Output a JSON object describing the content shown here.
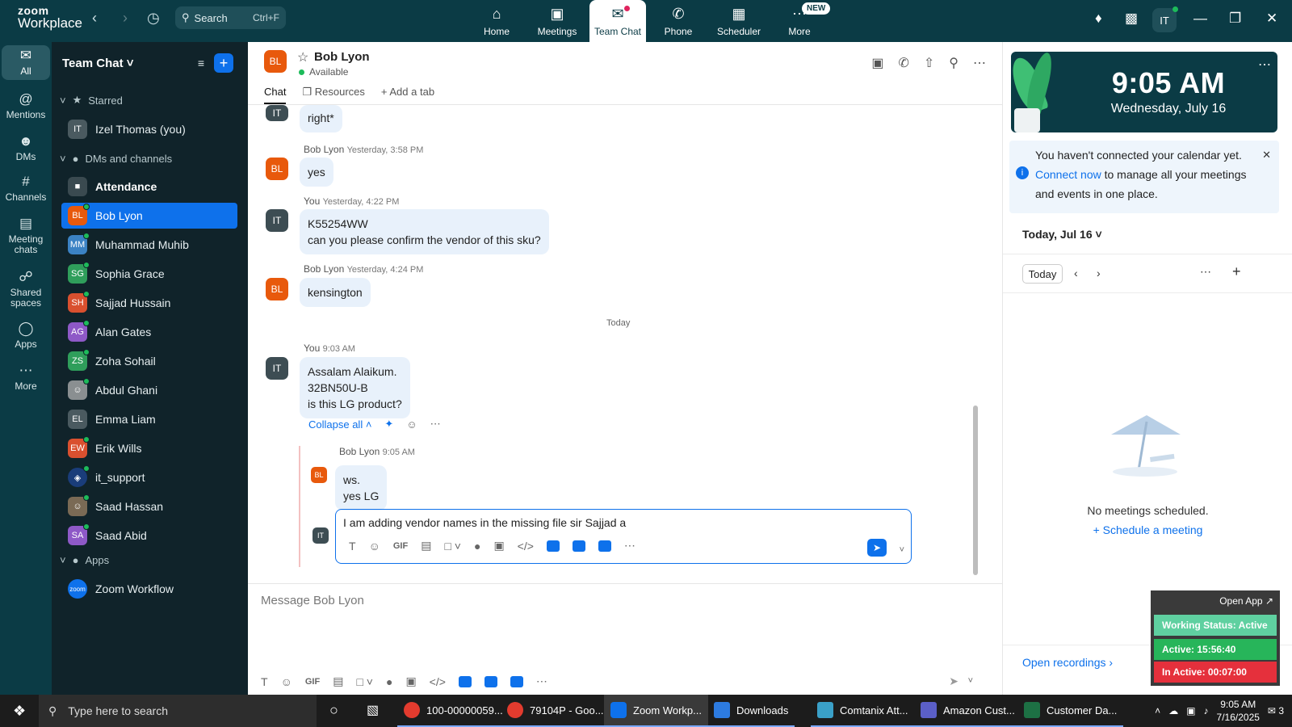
{
  "topbar": {
    "logo_line1": "zoom",
    "logo_line2": "Workplace",
    "search_label": "Search",
    "search_shortcut": "Ctrl+F",
    "tabs": [
      {
        "label": "Home",
        "icon": "home-icon"
      },
      {
        "label": "Meetings",
        "icon": "video-icon"
      },
      {
        "label": "Team Chat",
        "icon": "chat-icon"
      },
      {
        "label": "Phone",
        "icon": "phone-icon"
      },
      {
        "label": "Scheduler",
        "icon": "calendar-icon"
      },
      {
        "label": "More",
        "icon": "more-icon"
      }
    ],
    "new_badge": "NEW",
    "user_initials": "IT"
  },
  "rail": {
    "items": [
      {
        "label": "All"
      },
      {
        "label": "Mentions"
      },
      {
        "label": "DMs"
      },
      {
        "label": "Channels"
      },
      {
        "label": "Meeting chats"
      },
      {
        "label": "Shared spaces"
      },
      {
        "label": "Apps"
      },
      {
        "label": "More"
      }
    ]
  },
  "sidebar": {
    "title": "Team Chat",
    "starred_label": "Starred",
    "starred_items": [
      {
        "initials": "IT",
        "name": "Izel Thomas (you)"
      }
    ],
    "dms_label": "DMs and channels",
    "items": [
      {
        "initials": "",
        "name": "Attendance"
      },
      {
        "initials": "BL",
        "name": "Bob Lyon"
      },
      {
        "initials": "MM",
        "name": "Muhammad Muhib"
      },
      {
        "initials": "SG",
        "name": "Sophia Grace"
      },
      {
        "initials": "SH",
        "name": "Sajjad Hussain"
      },
      {
        "initials": "AG",
        "name": "Alan Gates"
      },
      {
        "initials": "ZS",
        "name": "Zoha Sohail"
      },
      {
        "initials": "",
        "name": "Abdul Ghani"
      },
      {
        "initials": "EL",
        "name": "Emma Liam"
      },
      {
        "initials": "EW",
        "name": "Erik Wills"
      },
      {
        "initials": "",
        "name": "it_support"
      },
      {
        "initials": "",
        "name": "Saad Hassan"
      },
      {
        "initials": "SA",
        "name": "Saad Abid"
      }
    ],
    "apps_label": "Apps",
    "apps": [
      {
        "name": "Zoom Workflow",
        "initials": "zoom"
      }
    ]
  },
  "chat": {
    "contact_initials": "BL",
    "contact_name": "Bob Lyon",
    "contact_status": "Available",
    "tabs": [
      "Chat",
      "Resources",
      "Add a tab"
    ],
    "messages": [
      {
        "initials": "IT",
        "sender": "",
        "time": "",
        "text": "right*"
      },
      {
        "initials": "BL",
        "sender": "Bob Lyon",
        "time": "Yesterday, 3:58 PM",
        "text": "yes"
      },
      {
        "initials": "IT",
        "sender": "You",
        "time": "Yesterday, 4:22 PM",
        "text": "K55254WW\ncan you please confirm the vendor of this sku?"
      },
      {
        "initials": "BL",
        "sender": "Bob Lyon",
        "time": "Yesterday, 4:24 PM",
        "text": "kensington"
      },
      {
        "initials": "IT",
        "sender": "You",
        "time": "9:03 AM",
        "text": "Assalam Alaikum.\n32BN50U-B\nis this LG product?"
      }
    ],
    "day_divider": "Today",
    "collapse_label": "Collapse all",
    "reply": {
      "initials": "BL",
      "sender": "Bob Lyon",
      "time": "9:05 AM",
      "text": "ws.\nyes LG"
    },
    "reply_draft_initials": "IT",
    "reply_draft": "I am adding vendor names in the missing file sir Sajjad a",
    "compose_placeholder": "Message Bob Lyon",
    "toolbar_gif": "GIF"
  },
  "rpanel": {
    "time": "9:05 AM",
    "date": "Wednesday, July 16",
    "notice_pre": "You haven't connected your calendar yet.",
    "notice_link": "Connect now",
    "notice_post": "to manage all your meetings and events in one place.",
    "date_label": "Today, Jul 16",
    "today_btn": "Today",
    "no_meetings": "No meetings scheduled.",
    "schedule": "Schedule a meeting",
    "open_recordings": "Open recordings"
  },
  "widget": {
    "open_app": "Open App",
    "status": "Working Status: Active",
    "active": "Active: 15:56:40",
    "inactive": "In Active: 00:07:00"
  },
  "taskbar": {
    "search_placeholder": "Type here to search",
    "apps": [
      {
        "label": "100-00000059...",
        "color": "#e33b2e"
      },
      {
        "label": "79104P - Goo...",
        "color": "#e33b2e"
      },
      {
        "label": "Zoom Workp...",
        "color": "#0e71eb"
      },
      {
        "label": "Downloads",
        "color": "#2d7be0"
      },
      {
        "label": "Comtanix Att...",
        "color": "#3aa0c8"
      },
      {
        "label": "Amazon Cust...",
        "color": "#5b5fc7"
      },
      {
        "label": "Customer Da...",
        "color": "#1d7044"
      }
    ],
    "time": "9:05 AM",
    "date": "7/16/2025",
    "notif_count": "3"
  },
  "colors": {
    "brand": "#0b3b45",
    "accent": "#0e71eb",
    "online": "#1dbb5a"
  }
}
